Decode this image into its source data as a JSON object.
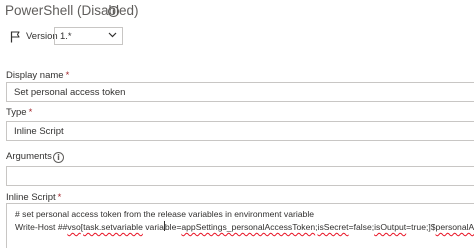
{
  "task": {
    "title": "PowerShell (Disabled)"
  },
  "version": {
    "label": "Version",
    "value": "1.*"
  },
  "display_name": {
    "label": "Display name",
    "required_mark": "*",
    "value": "Set personal access token"
  },
  "type": {
    "label": "Type",
    "required_mark": "*",
    "value": "Inline Script"
  },
  "arguments": {
    "label": "Arguments",
    "value": ""
  },
  "inline_script": {
    "label": "Inline Script",
    "required_mark": "*",
    "line1": "# set personal access token from the release variables in environment variable",
    "line2": {
      "p1": "Write-Host ##",
      "p2": "vso",
      "p3": "[",
      "p4": "task.setvariable",
      "p5": " varia",
      "p6": "ble=",
      "p7": "appSettings_personalAccessToken",
      "p8": ";",
      "p9": "isSecret",
      "p10": "=false;",
      "p11": "isOutput",
      "p12": "=true;]$",
      "p13": "personalAccessToken"
    }
  }
}
